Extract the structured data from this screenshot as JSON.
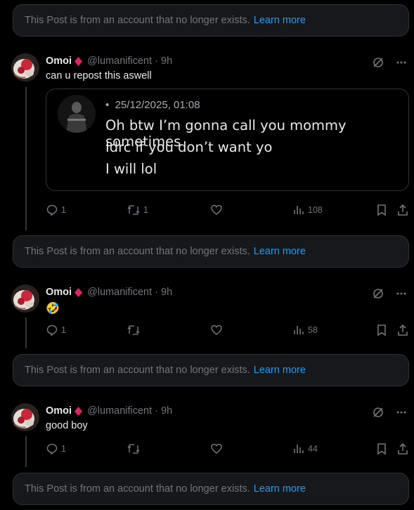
{
  "notice": {
    "text": "This Post is from an account that no longer exists.",
    "link": "Learn more"
  },
  "posts": [
    {
      "name": "Omoi",
      "handle": "@lumanificent",
      "time": "9h",
      "text": "can u repost this aswell",
      "quote": {
        "timestamp": "25/12/2025, 01:08",
        "lines": [
          "Oh btw I’m gonna call you mommy sometimes",
          "Idrc if you don’t want yo",
          "I will lol"
        ]
      },
      "replies": "1",
      "reposts": "1",
      "likes": "",
      "views": "108"
    },
    {
      "name": "Omoi",
      "handle": "@lumanificent",
      "time": "9h",
      "text": "🤣",
      "replies": "1",
      "reposts": "",
      "likes": "",
      "views": "58"
    },
    {
      "name": "Omoi",
      "handle": "@lumanificent",
      "time": "9h",
      "text": "good boy",
      "replies": "1",
      "reposts": "",
      "likes": "",
      "views": "44"
    }
  ],
  "colors": {
    "accent": "#1d9bf0",
    "muted": "#71767b",
    "diamond": "#e0245e"
  },
  "icons": [
    "reply-icon",
    "repost-icon",
    "like-icon",
    "views-icon",
    "bookmark-icon",
    "share-icon",
    "grok-icon",
    "more-icon"
  ]
}
